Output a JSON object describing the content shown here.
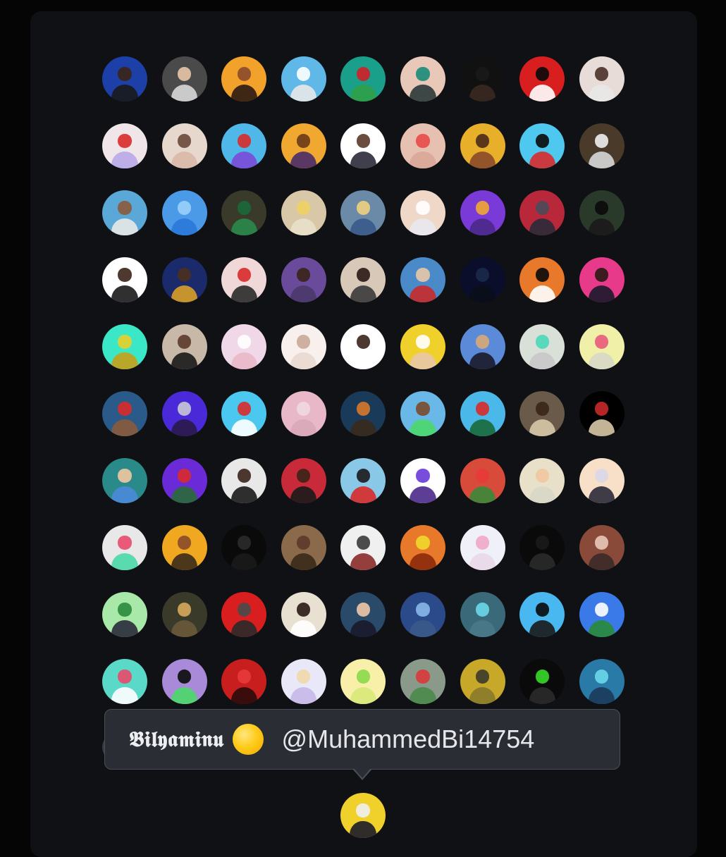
{
  "tooltip": {
    "display_name": "𝕭𝖎𝖑𝖞𝖆𝖒𝖎𝖓𝖚",
    "emoji": "yellow-circle-emoji",
    "handle": "@MuhammedBi14754"
  },
  "avatars": [
    {
      "bg": "#1d3fa8",
      "face": "#3b2414",
      "body": "#1a1a1a"
    },
    {
      "bg": "#4a4a4a",
      "face": "#e8c8a8",
      "body": "#d8d8d8"
    },
    {
      "bg": "#f2a12a",
      "face": "#8a4a2a",
      "body": "#2a1a12"
    },
    {
      "bg": "#5fb8e8",
      "face": "#ffffff",
      "body": "#e8e8e8"
    },
    {
      "bg": "#1aa08a",
      "face": "#d01f28",
      "body": "#2fa048"
    },
    {
      "bg": "#e8c8b8",
      "face": "#1a8a78",
      "body": "#2a3a3a"
    },
    {
      "bg": "#111111",
      "face": "#1a1a1a",
      "body": "#3a2a22"
    },
    {
      "bg": "#d81e1e",
      "face": "#0a0a0a",
      "body": "#ffffff"
    },
    {
      "bg": "#e8dcd8",
      "face": "#4a3028",
      "body": "#e8e8e8"
    },
    {
      "bg": "#f0e6ea",
      "face": "#d82a2a",
      "body": "#b8a8e8"
    },
    {
      "bg": "#e6d8cc",
      "face": "#6a4a3a",
      "body": "#d8b8a8"
    },
    {
      "bg": "#4fb8e8",
      "face": "#d82a2a",
      "body": "#7a4ad8"
    },
    {
      "bg": "#f0a830",
      "face": "#6a3a1a",
      "body": "#4a2a6a"
    },
    {
      "bg": "#ffffff",
      "face": "#5a3a2a",
      "body": "#2a2a3a"
    },
    {
      "bg": "#e6c0b0",
      "face": "#e84a4a",
      "body": "#d8a898"
    },
    {
      "bg": "#e8b02a",
      "face": "#4a2a18",
      "body": "#8a4a2a"
    },
    {
      "bg": "#4fc8f0",
      "face": "#0a0a0a",
      "body": "#d82a2a"
    },
    {
      "bg": "#4a3a2a",
      "face": "#f0f0f0",
      "body": "#d8d8d8"
    },
    {
      "bg": "#5aa8d8",
      "face": "#8a5a3a",
      "body": "#e8e8e8"
    },
    {
      "bg": "#4a9ae8",
      "face": "#9ad0f8",
      "body": "#2a78d8"
    },
    {
      "bg": "#3a3a2a",
      "face": "#1a6a3a",
      "body": "#2a8a4a"
    },
    {
      "bg": "#d8c8a8",
      "face": "#f0d060",
      "body": "#e8e0c8"
    },
    {
      "bg": "#6a8aa8",
      "face": "#f0d080",
      "body": "#3a5a8a"
    },
    {
      "bg": "#f0d8c8",
      "face": "#ffffff",
      "body": "#e8e8f0"
    },
    {
      "bg": "#7a3ad8",
      "face": "#f0a830",
      "body": "#4a2a8a"
    },
    {
      "bg": "#b8283a",
      "face": "#4a4a5a",
      "body": "#2a2a3a"
    },
    {
      "bg": "#2a3a2a",
      "face": "#0a0a0a",
      "body": "#1a1a1a"
    },
    {
      "bg": "#ffffff",
      "face": "#3a2418",
      "body": "#1a1a1a"
    },
    {
      "bg": "#1a2a6a",
      "face": "#4a3020",
      "body": "#d8a028"
    },
    {
      "bg": "#f0d8d8",
      "face": "#d82a2a",
      "body": "#2a2a2a"
    },
    {
      "bg": "#6a4a9a",
      "face": "#3a2418",
      "body": "#4a3a6a"
    },
    {
      "bg": "#d8c8b8",
      "face": "#2a1a14",
      "body": "#3a3a3a"
    },
    {
      "bg": "#4a8ac8",
      "face": "#e8c8a8",
      "body": "#c82a2a"
    },
    {
      "bg": "#0a0e2a",
      "face": "#1a2a4a",
      "body": "#0a0e1a"
    },
    {
      "bg": "#e8782a",
      "face": "#0a0a0a",
      "body": "#ffffff"
    },
    {
      "bg": "#e83a8a",
      "face": "#2a1a14",
      "body": "#1a1a2a"
    },
    {
      "bg": "#3ae8c8",
      "face": "#e8d02a",
      "body": "#c8a018"
    },
    {
      "bg": "#c8b8a8",
      "face": "#5a3a2a",
      "body": "#1a1a1a"
    },
    {
      "bg": "#f0d8e8",
      "face": "#ffffff",
      "body": "#e8b8c8"
    },
    {
      "bg": "#f8f0ec",
      "face": "#c8a898",
      "body": "#e8d8d0"
    },
    {
      "bg": "#ffffff",
      "face": "#3a2418",
      "body": "#ffffff"
    },
    {
      "bg": "#f0d02a",
      "face": "#ffffff",
      "body": "#e8c8a8"
    },
    {
      "bg": "#5a8ad8",
      "face": "#d8a878",
      "body": "#1a1a2a"
    },
    {
      "bg": "#d8e0d8",
      "face": "#4ad8b8",
      "body": "#c8c8c8"
    },
    {
      "bg": "#f0f0a8",
      "face": "#e85a7a",
      "body": "#d8d8c8"
    },
    {
      "bg": "#2a5a8a",
      "face": "#d82a2a",
      "body": "#8a5a3a"
    },
    {
      "bg": "#4a2ad8",
      "face": "#c8c8d8",
      "body": "#2a1a4a"
    },
    {
      "bg": "#4ac8f0",
      "face": "#d82a2a",
      "body": "#ffffff"
    },
    {
      "bg": "#e8b8c8",
      "face": "#f0d8e0",
      "body": "#d8a8b8"
    },
    {
      "bg": "#1a3a5a",
      "face": "#d8782a",
      "body": "#3a2a1a"
    },
    {
      "bg": "#6ab8e8",
      "face": "#7a4a2a",
      "body": "#4ad86a"
    },
    {
      "bg": "#4ab8e8",
      "face": "#d82a2a",
      "body": "#1a6a3a"
    },
    {
      "bg": "#6a5a4a",
      "face": "#3a2418",
      "body": "#d8c8a8"
    },
    {
      "bg": "#000000",
      "face": "#c82a2a",
      "body": "#d8c8a8"
    },
    {
      "bg": "#2a8a8a",
      "face": "#f0c8a0",
      "body": "#4a8ad8"
    },
    {
      "bg": "#6a2ad8",
      "face": "#d82a2a",
      "body": "#2a6a3a"
    },
    {
      "bg": "#e8e8e8",
      "face": "#3a2418",
      "body": "#1a1a1a"
    },
    {
      "bg": "#c82a3a",
      "face": "#3a2418",
      "body": "#1a1a1a"
    },
    {
      "bg": "#8ac8e8",
      "face": "#1a1a1a",
      "body": "#d82a2a"
    },
    {
      "bg": "#ffffff",
      "face": "#6a3ad8",
      "body": "#4a2a8a"
    },
    {
      "bg": "#d84a3a",
      "face": "#e83a3a",
      "body": "#3a8a3a"
    },
    {
      "bg": "#e8e0c8",
      "face": "#f0c8a0",
      "body": "#d8d8c8"
    },
    {
      "bg": "#f8e0c8",
      "face": "#d8d8e8",
      "body": "#2a2a3a"
    },
    {
      "bg": "#e8e8e8",
      "face": "#e84a6a",
      "body": "#4ad8a8"
    },
    {
      "bg": "#f0a820",
      "face": "#8a4a2a",
      "body": "#3a2a1a"
    },
    {
      "bg": "#0a0a0a",
      "face": "#2a2a2a",
      "body": "#1a1a1a"
    },
    {
      "bg": "#8a6a4a",
      "face": "#5a3a2a",
      "body": "#3a2a1a"
    },
    {
      "bg": "#f0f0f0",
      "face": "#3a3a3a",
      "body": "#8a2a2a"
    },
    {
      "bg": "#e8782a",
      "face": "#f0d82a",
      "body": "#8a2a0a"
    },
    {
      "bg": "#f0f0f8",
      "face": "#f0a8c8",
      "body": "#e8d8e8"
    },
    {
      "bg": "#0a0a0a",
      "face": "#1a1a1a",
      "body": "#2a2a2a"
    },
    {
      "bg": "#8a4a3a",
      "face": "#e8c8b8",
      "body": "#3a2a2a"
    },
    {
      "bg": "#a8e8a8",
      "face": "#2a8a3a",
      "body": "#2a2a3a"
    },
    {
      "bg": "#3a3a2a",
      "face": "#d8a85a",
      "body": "#6a5a3a"
    },
    {
      "bg": "#d81e1e",
      "face": "#4a4a4a",
      "body": "#2a2a2a"
    },
    {
      "bg": "#e8e0d0",
      "face": "#2a1a14",
      "body": "#ffffff"
    },
    {
      "bg": "#2a4a6a",
      "face": "#f0c8a8",
      "body": "#1a1a2a"
    },
    {
      "bg": "#2a4a8a",
      "face": "#8ab8e8",
      "body": "#3a5a8a"
    },
    {
      "bg": "#3a6a7a",
      "face": "#6ad8e8",
      "body": "#4a7a8a"
    },
    {
      "bg": "#4ab8f0",
      "face": "#0a0a0a",
      "body": "#1a1a1a"
    },
    {
      "bg": "#3a7ae8",
      "face": "#ffffff",
      "body": "#2a8a3a"
    },
    {
      "bg": "#5ad8c8",
      "face": "#e84a6a",
      "body": "#ffffff"
    },
    {
      "bg": "#a88ad8",
      "face": "#0a0a0a",
      "body": "#4ad86a"
    },
    {
      "bg": "#c81e1e",
      "face": "#e83a3a",
      "body": "#2a0a0a"
    },
    {
      "bg": "#e8e8f8",
      "face": "#f0d8a8",
      "body": "#c8b8e8"
    },
    {
      "bg": "#f8f0a8",
      "face": "#8ad84a",
      "body": "#d8e878"
    },
    {
      "bg": "#8a9a8a",
      "face": "#d83a3a",
      "body": "#4a8a4a"
    },
    {
      "bg": "#c8a828",
      "face": "#3a3a2a",
      "body": "#8a7a2a"
    },
    {
      "bg": "#0a0a0a",
      "face": "#3ad82a",
      "body": "#2a2a2a"
    },
    {
      "bg": "#2a7aa8",
      "face": "#6ad8e8",
      "body": "#1a3a5a"
    }
  ],
  "bottom_avatar": {
    "bg": "#f0d02a",
    "face": "#f0f0f0",
    "body": "#1a1a2a"
  }
}
